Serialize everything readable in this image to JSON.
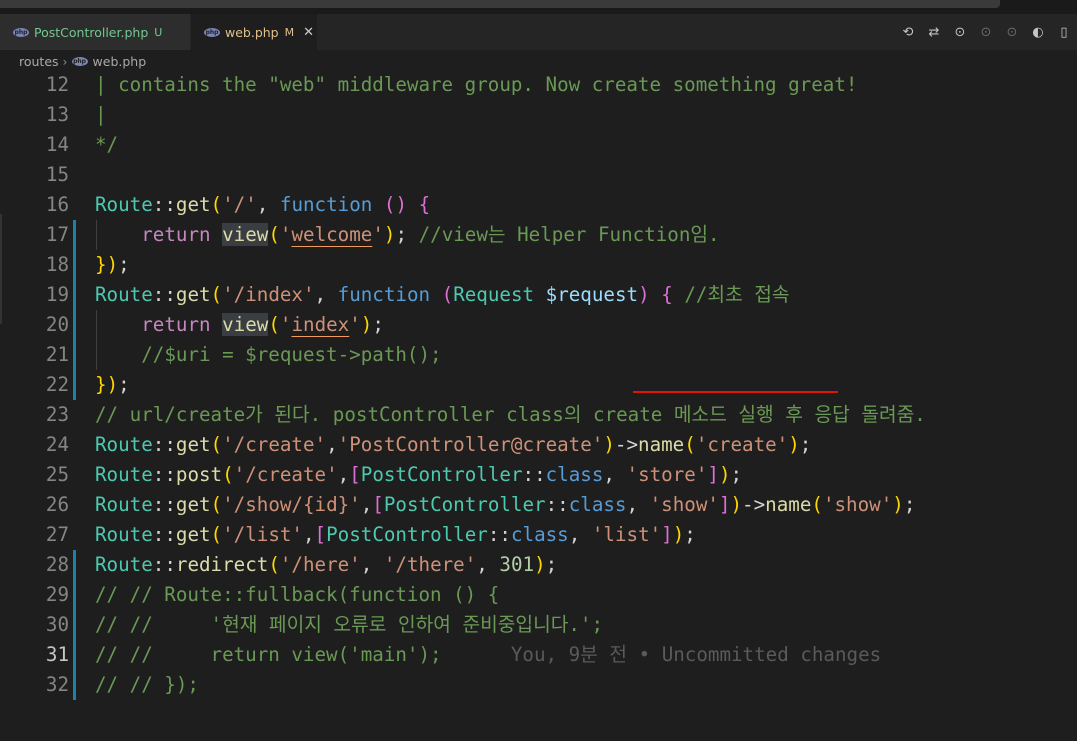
{
  "tabs": [
    {
      "name": "PostController.php",
      "status": "U",
      "icon": "php-icon"
    },
    {
      "name": "web.php",
      "status": "M",
      "close": "✕",
      "icon": "php-icon"
    }
  ],
  "toolbar_icons": [
    "timeline-icon",
    "git-compare-icon",
    "go-back-icon",
    "go-dot-icon",
    "go-forward-icon",
    "git-blame-icon",
    "split-editor-icon"
  ],
  "breadcrumb": {
    "folder": "routes",
    "file": "web.php"
  },
  "blame": "You, 9분 전 • Uncommitted changes",
  "lines": [
    {
      "n": "12",
      "text": "| contains the \"web\" middleware group. Now create something great!"
    },
    {
      "n": "13",
      "text": "|"
    },
    {
      "n": "14",
      "text": "*/"
    },
    {
      "n": "15",
      "text": ""
    },
    {
      "n": "16",
      "text": "Route::get('/', function () {"
    },
    {
      "n": "17",
      "text": "    return view('welcome'); //view는 Helper Function임."
    },
    {
      "n": "18",
      "text": "});"
    },
    {
      "n": "19",
      "text": "Route::get('/index', function (Request $request) { //최초 접속"
    },
    {
      "n": "20",
      "text": "    return view('index');"
    },
    {
      "n": "21",
      "text": "    //$uri = $request->path();"
    },
    {
      "n": "22",
      "text": "});"
    },
    {
      "n": "23",
      "text": "// url/create가 된다. postController class의 create 메소드 실행 후 응답 돌려줌."
    },
    {
      "n": "24",
      "text": "Route::get('/create','PostController@create')->name('create');"
    },
    {
      "n": "25",
      "text": "Route::post('/create',[PostController::class, 'store']);"
    },
    {
      "n": "26",
      "text": "Route::get('/show/{id}',[PostController::class, 'show'])->name('show');"
    },
    {
      "n": "27",
      "text": "Route::get('/list',[PostController::class, 'list']);"
    },
    {
      "n": "28",
      "text": "Route::redirect('/here', '/there', 301);"
    },
    {
      "n": "29",
      "text": "// // Route::fullback(function () {"
    },
    {
      "n": "30",
      "text": "// //     '현재 페이지 오류로 인하여 준비중입니다.';"
    },
    {
      "n": "31",
      "text": "// //     return view('main');"
    },
    {
      "n": "32",
      "text": "// // });"
    }
  ],
  "active_line": "31",
  "colors": {
    "comment": "#6a9955",
    "keyword": "#569cd6",
    "class": "#4ec9b0",
    "function": "#dcdcaa",
    "string": "#ce9178",
    "variable": "#9cdcfe",
    "number": "#b5cea8",
    "gutter_modified": "#1b81a8",
    "error_underline": "#e51400"
  }
}
